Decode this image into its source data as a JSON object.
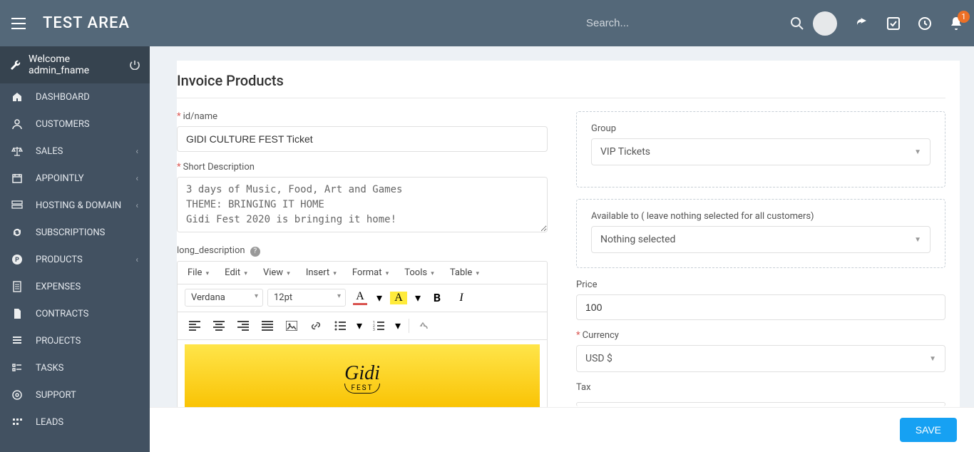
{
  "header": {
    "brand": "TEST AREA",
    "search_placeholder": "Search...",
    "bell_badge": "1"
  },
  "sidebar": {
    "welcome": "Welcome admin_fname",
    "items": [
      {
        "label": "DASHBOARD",
        "icon": "home-icon",
        "has_sub": false
      },
      {
        "label": "CUSTOMERS",
        "icon": "user-icon",
        "has_sub": false
      },
      {
        "label": "SALES",
        "icon": "scales-icon",
        "has_sub": true
      },
      {
        "label": "APPOINTLY",
        "icon": "calendar-icon",
        "has_sub": true
      },
      {
        "label": "HOSTING & DOMAIN",
        "icon": "server-icon",
        "has_sub": true
      },
      {
        "label": "SUBSCRIPTIONS",
        "icon": "refresh-icon",
        "has_sub": false
      },
      {
        "label": "PRODUCTS",
        "icon": "product-icon",
        "has_sub": true
      },
      {
        "label": "EXPENSES",
        "icon": "doc-lines-icon",
        "has_sub": false
      },
      {
        "label": "CONTRACTS",
        "icon": "doc-icon",
        "has_sub": false
      },
      {
        "label": "PROJECTS",
        "icon": "bars-icon",
        "has_sub": false
      },
      {
        "label": "TASKS",
        "icon": "tasks-icon",
        "has_sub": false
      },
      {
        "label": "SUPPORT",
        "icon": "support-icon",
        "has_sub": false
      },
      {
        "label": "LEADS",
        "icon": "leads-icon",
        "has_sub": false
      }
    ]
  },
  "page": {
    "title": "Invoice Products",
    "save_label": "SAVE"
  },
  "form": {
    "id_name_label": "id/name",
    "id_name_value": "GIDI CULTURE FEST Ticket",
    "short_desc_label": "Short Description",
    "short_desc_value": "3 days of Music, Food, Art and Games\nTHEME: BRINGING IT HOME\nGidi Fest 2020 is bringing it home!",
    "long_desc_label": "long_description",
    "group_label": "Group",
    "group_value": "VIP Tickets",
    "available_label": "Available to ( leave nothing selected for all customers)",
    "available_value": "Nothing selected",
    "price_label": "Price",
    "price_value": "100",
    "currency_label": "Currency",
    "currency_value": "USD $",
    "tax_label": "Tax"
  },
  "editor": {
    "menus": [
      "File",
      "Edit",
      "View",
      "Insert",
      "Format",
      "Tools",
      "Table"
    ],
    "font_family": "Verdana",
    "font_size": "12pt",
    "banner_logo": "Gidi",
    "banner_sub": "FEST"
  }
}
